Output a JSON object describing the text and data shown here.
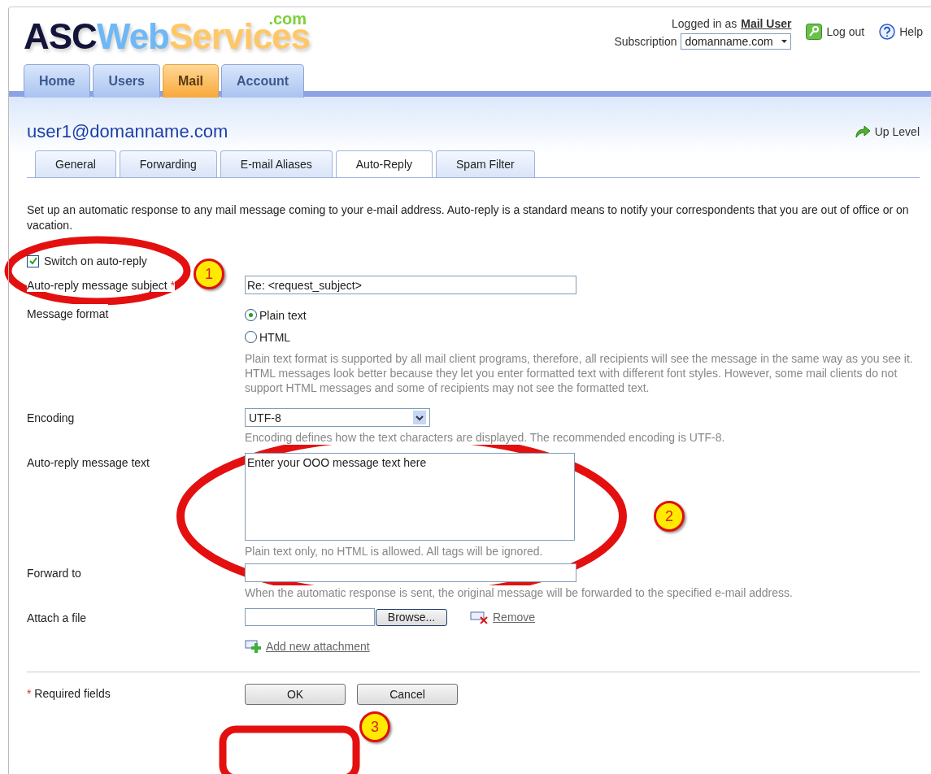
{
  "logo": {
    "parts": [
      "ASC",
      "Web",
      "Services"
    ],
    "suffix": ".com"
  },
  "user": {
    "label": "Logged in as",
    "name": "Mail User"
  },
  "subscription": {
    "label": "Subscription",
    "value": "domanname.com"
  },
  "header_links": [
    "Log out",
    "Help"
  ],
  "main_tabs": [
    {
      "label": "Home",
      "selected": false
    },
    {
      "label": "Users",
      "selected": false
    },
    {
      "label": "Mail",
      "selected": true
    },
    {
      "label": "Account",
      "selected": false
    }
  ],
  "page_title": "user1@domanname.com",
  "up_level": "Up Level",
  "sub_tabs": [
    {
      "label": "General",
      "selected": false
    },
    {
      "label": "Forwarding",
      "selected": false
    },
    {
      "label": "E-mail Aliases",
      "selected": false
    },
    {
      "label": "Auto-Reply",
      "selected": true
    },
    {
      "label": "Spam Filter",
      "selected": false
    }
  ],
  "intro": "Set up an automatic response to any mail message coming to your e-mail address. Auto-reply is a standard means to notify your correspondents that you are out of office or on vacation.",
  "switch": {
    "label": "Switch on auto-reply",
    "checked": true
  },
  "fields": [
    {
      "kind": "text",
      "label": "Auto-reply message subject",
      "required": true,
      "value": "Re: <request_subject>"
    },
    {
      "kind": "radio",
      "label": "Message format",
      "options": [
        {
          "label": "Plain text",
          "selected": true
        },
        {
          "label": "HTML",
          "selected": false
        }
      ],
      "hint": "Plain text format is supported by all mail client programs, therefore, all recipients will see the message in the same way as you see it. HTML messages look better because they let you enter formatted text with different font styles. However, some mail clients do not support HTML messages and some of recipients may not see the formatted text."
    },
    {
      "kind": "select",
      "label": "Encoding",
      "value": "UTF-8",
      "hint": "Encoding defines how the text characters are displayed. The recommended encoding is UTF-8."
    },
    {
      "kind": "textarea",
      "label": "Auto-reply message text",
      "value": "Enter your OOO message text here",
      "hint": "Plain text only, no HTML is allowed. All tags will be ignored."
    },
    {
      "kind": "text",
      "label": "Forward to",
      "hint": "When the automatic response is sent, the original message will be forwarded to the specified e-mail address."
    },
    {
      "kind": "file",
      "label": "Attach a file",
      "button": "Browse...",
      "remove": "Remove",
      "add": "Add new attachment"
    }
  ],
  "required_mark": "*",
  "required_note": "Required fields",
  "buttons": [
    "OK",
    "Cancel"
  ],
  "callouts": [
    "1",
    "2",
    "3"
  ]
}
